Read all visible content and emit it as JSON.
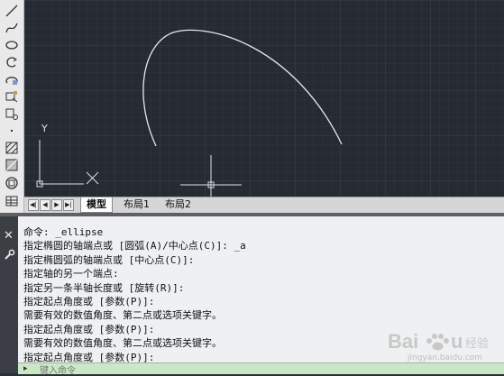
{
  "toolbar": {
    "tools": [
      "line-icon",
      "spline-icon",
      "ellipse-icon",
      "rotate-icon",
      "ellipse-arc-icon",
      "insert-block-icon",
      "make-block-icon",
      "point-icon",
      "hatch-icon",
      "gradient-icon",
      "region-icon",
      "table-icon"
    ]
  },
  "canvas": {
    "ucs_y_label": "Y",
    "background_color": "#262b33",
    "curve_color": "#e6e6e6"
  },
  "tabs": {
    "nav": [
      "◀|",
      "◀",
      "▶",
      "▶|"
    ],
    "items": [
      "模型",
      "布局1",
      "布局2"
    ],
    "active": "模型"
  },
  "command": {
    "lines": [
      "命令: _ellipse",
      "指定椭圆的轴端点或 [圆弧(A)/中心点(C)]: _a",
      "指定椭圆弧的轴端点或 [中心点(C)]:",
      "指定轴的另一个端点:",
      "指定另一条半轴长度或 [旋转(R)]:",
      "指定起点角度或 [参数(P)]:",
      "需要有效的数值角度、第二点或选项关键字。",
      "指定起点角度或 [参数(P)]:",
      "需要有效的数值角度、第二点或选项关键字。",
      "指定起点角度或 [参数(P)]:"
    ],
    "input_placeholder": "键入命令"
  },
  "watermark": {
    "brand": "Baidu 经验",
    "url": "jingyan.baidu.com"
  }
}
